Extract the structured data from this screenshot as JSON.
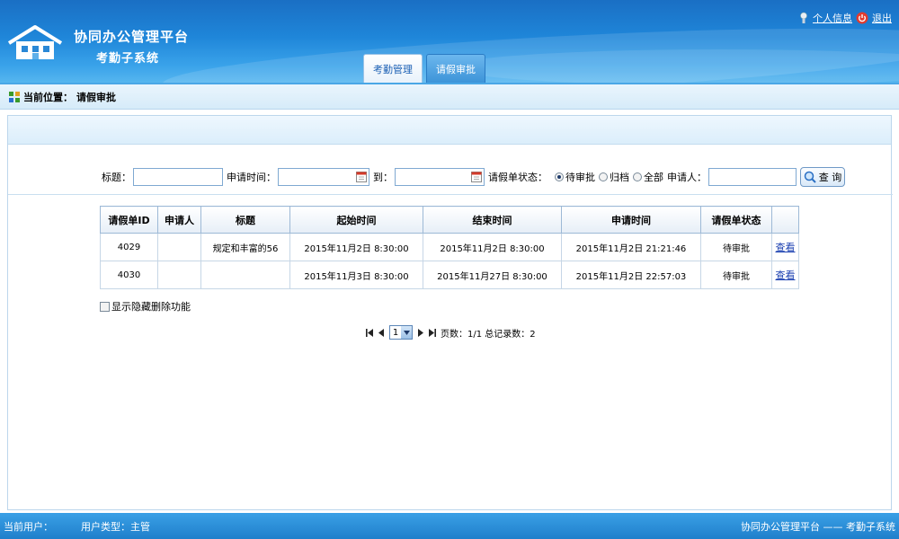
{
  "app": {
    "title": "协同办公管理平台",
    "subtitle": "考勤子系统"
  },
  "top_links": {
    "profile": "个人信息",
    "logout": "退出"
  },
  "tabs": [
    {
      "label": "考勤管理",
      "active": false
    },
    {
      "label": "请假审批",
      "active": true
    }
  ],
  "location": {
    "label": "当前位置：",
    "page": "请假审批"
  },
  "search": {
    "title_label": "标题：",
    "title_value": "",
    "apply_time_label": "申请时间：",
    "apply_from_value": "",
    "to_label": "到：",
    "apply_to_value": "",
    "status_label": "请假单状态：",
    "status_options": [
      "待审批",
      "归档",
      "全部"
    ],
    "status_selected": "待审批",
    "applicant_label": "申请人：",
    "applicant_value": "",
    "query_button": "查 询"
  },
  "table": {
    "headers": [
      "请假单ID",
      "申请人",
      "标题",
      "起始时间",
      "结束时间",
      "申请时间",
      "请假单状态",
      ""
    ],
    "rows": [
      [
        "4029",
        "",
        "规定和丰富的56",
        "2015年11月2日 8:30:00",
        "2015年11月2日 8:30:00",
        "2015年11月2日 21:21:46",
        "待审批",
        "查看"
      ],
      [
        "4030",
        "",
        "",
        "2015年11月3日 8:30:00",
        "2015年11月27日 8:30:00",
        "2015年11月2日 22:57:03",
        "待审批",
        "查看"
      ]
    ]
  },
  "options": {
    "show_hidden_delete": "显示隐藏删除功能"
  },
  "pager": {
    "current_page": "1",
    "info": "页数：1/1 总记录数：2"
  },
  "footer": {
    "current_user": "当前用户：",
    "user_type": "用户类型：主管",
    "system": "协同办公管理平台 —— 考勤子系统"
  },
  "colors": {
    "header_blue": "#1f86d9",
    "footer_blue": "#2a8fd8",
    "link_blue": "#1a3fb0"
  }
}
